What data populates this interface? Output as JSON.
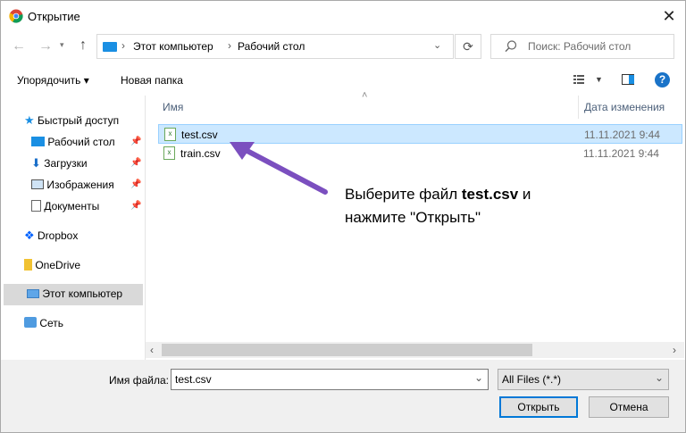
{
  "window": {
    "title": "Открытие"
  },
  "address": {
    "segments": [
      "Этот компьютер",
      "Рабочий стол"
    ]
  },
  "search": {
    "placeholder": "Поиск: Рабочий стол"
  },
  "toolbar": {
    "organize_label": "Упорядочить ▾",
    "new_folder_label": "Новая папка"
  },
  "sidebar": {
    "items": [
      {
        "label": "Быстрый доступ",
        "icon": "star-icon"
      },
      {
        "label": "Рабочий стол",
        "icon": "desktop-icon"
      },
      {
        "label": "Загрузки",
        "icon": "download-icon"
      },
      {
        "label": "Изображения",
        "icon": "images-icon"
      },
      {
        "label": "Документы",
        "icon": "documents-icon"
      },
      {
        "label": "Dropbox",
        "icon": "dropbox-icon"
      },
      {
        "label": "OneDrive",
        "icon": "onedrive-icon"
      },
      {
        "label": "Этот компьютер",
        "icon": "computer-icon"
      },
      {
        "label": "Сеть",
        "icon": "network-icon"
      }
    ]
  },
  "columns": {
    "name": "Имя",
    "date": "Дата изменения"
  },
  "files": [
    {
      "name": "test.csv",
      "date": "11.11.2021 9:44",
      "selected": true
    },
    {
      "name": "train.csv",
      "date": "11.11.2021 9:44",
      "selected": false
    }
  ],
  "annotation": {
    "line1_prefix": "Выберите файл ",
    "line1_bold": "test.csv",
    "line1_suffix": " и",
    "line2": "нажмите \"Открыть\""
  },
  "footer": {
    "filename_label": "Имя файла:",
    "filename_value": "test.csv",
    "filter_value": "All Files (*.*)",
    "open_label": "Открыть",
    "cancel_label": "Отмена"
  },
  "colors": {
    "accent": "#0078d7",
    "selection": "#cce8ff",
    "arrow": "#7b4fbf"
  }
}
